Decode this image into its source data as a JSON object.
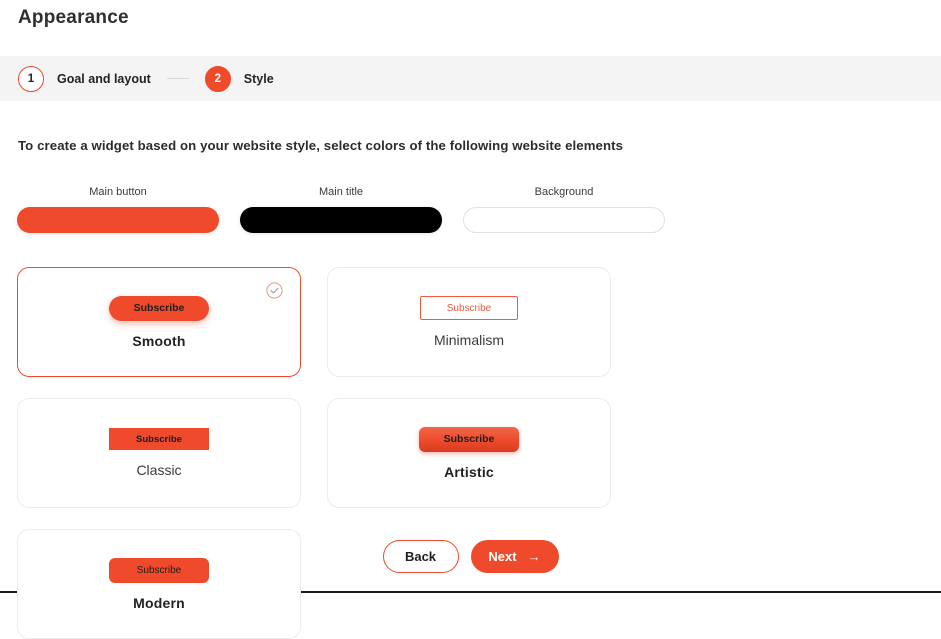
{
  "header": {
    "title": "Appearance"
  },
  "stepper": {
    "steps": [
      {
        "number": "1",
        "label": "Goal and layout",
        "state": "inactive"
      },
      {
        "number": "2",
        "label": "Style",
        "state": "active"
      }
    ]
  },
  "main": {
    "instructions": "To create a widget based on your website style, select colors of the following website elements",
    "color_swatches": [
      {
        "label": "Main button",
        "color": "#ee4a2b",
        "style": "filled"
      },
      {
        "label": "Main title",
        "color": "#000000",
        "style": "filled"
      },
      {
        "label": "Background",
        "color": "#ffffff",
        "style": "outlined"
      }
    ],
    "style_cards": [
      {
        "name": "Smooth",
        "button_label": "Subscribe",
        "selected": true,
        "check_icon": "check-circle-icon"
      },
      {
        "name": "Minimalism",
        "button_label": "Subscribe",
        "selected": false
      },
      {
        "name": "Classic",
        "button_label": "Subscribe",
        "selected": false
      },
      {
        "name": "Artistic",
        "button_label": "Subscribe",
        "selected": false
      },
      {
        "name": "Modern",
        "button_label": "Subscribe",
        "selected": false
      }
    ]
  },
  "footer": {
    "back_label": "Back",
    "next_label": "Next",
    "next_icon": "arrow-right-icon"
  },
  "colors": {
    "accent": "#ee4a2b",
    "stepper_bg": "#f4f4f4",
    "card_border": "#ececec",
    "text_dark": "#232323"
  }
}
